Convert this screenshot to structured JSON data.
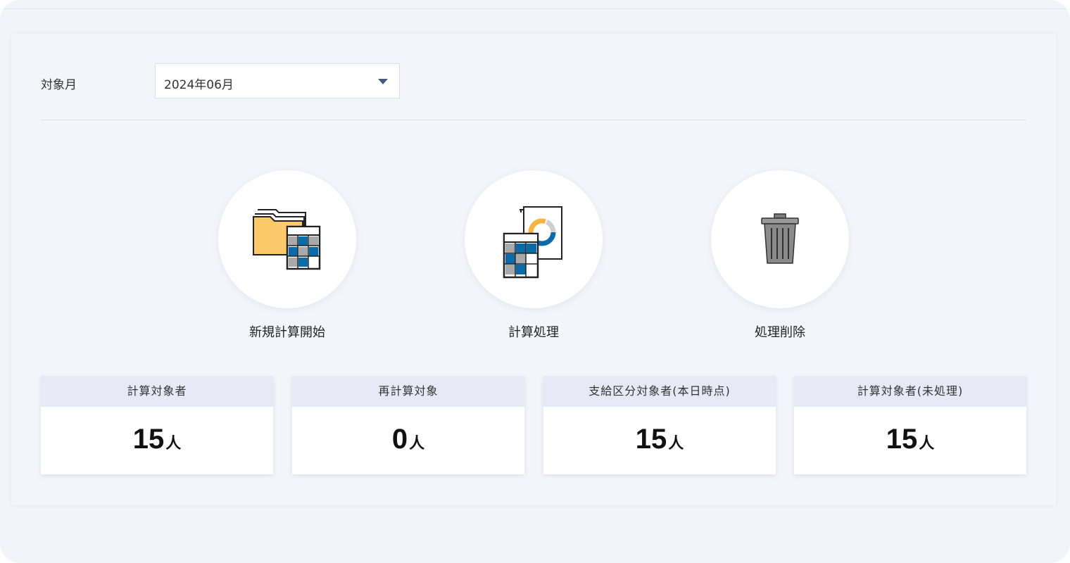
{
  "filter": {
    "label": "対象月",
    "selected_month": "2024年06月"
  },
  "actions": [
    {
      "label": "新規計算開始",
      "icon": "folder-spreadsheet-icon"
    },
    {
      "label": "計算処理",
      "icon": "document-chart-spreadsheet-icon"
    },
    {
      "label": "処理削除",
      "icon": "trash-icon"
    }
  ],
  "stats": [
    {
      "title": "計算対象者",
      "value": "15",
      "unit": "人"
    },
    {
      "title": "再計算対象",
      "value": "0",
      "unit": "人"
    },
    {
      "title": "支給区分対象者(本日時点)",
      "value": "15",
      "unit": "人"
    },
    {
      "title": "計算対象者(未処理)",
      "value": "15",
      "unit": "人"
    }
  ],
  "colors": {
    "background": "#f3f4f9",
    "card_header": "#e8e9f6",
    "folder_yellow": "#fcc96a",
    "grid_blue": "#0b6aa8",
    "grid_gray": "#a9a9a9",
    "chart_orange": "#f5b342",
    "trash_gray": "#8a8a8a"
  }
}
